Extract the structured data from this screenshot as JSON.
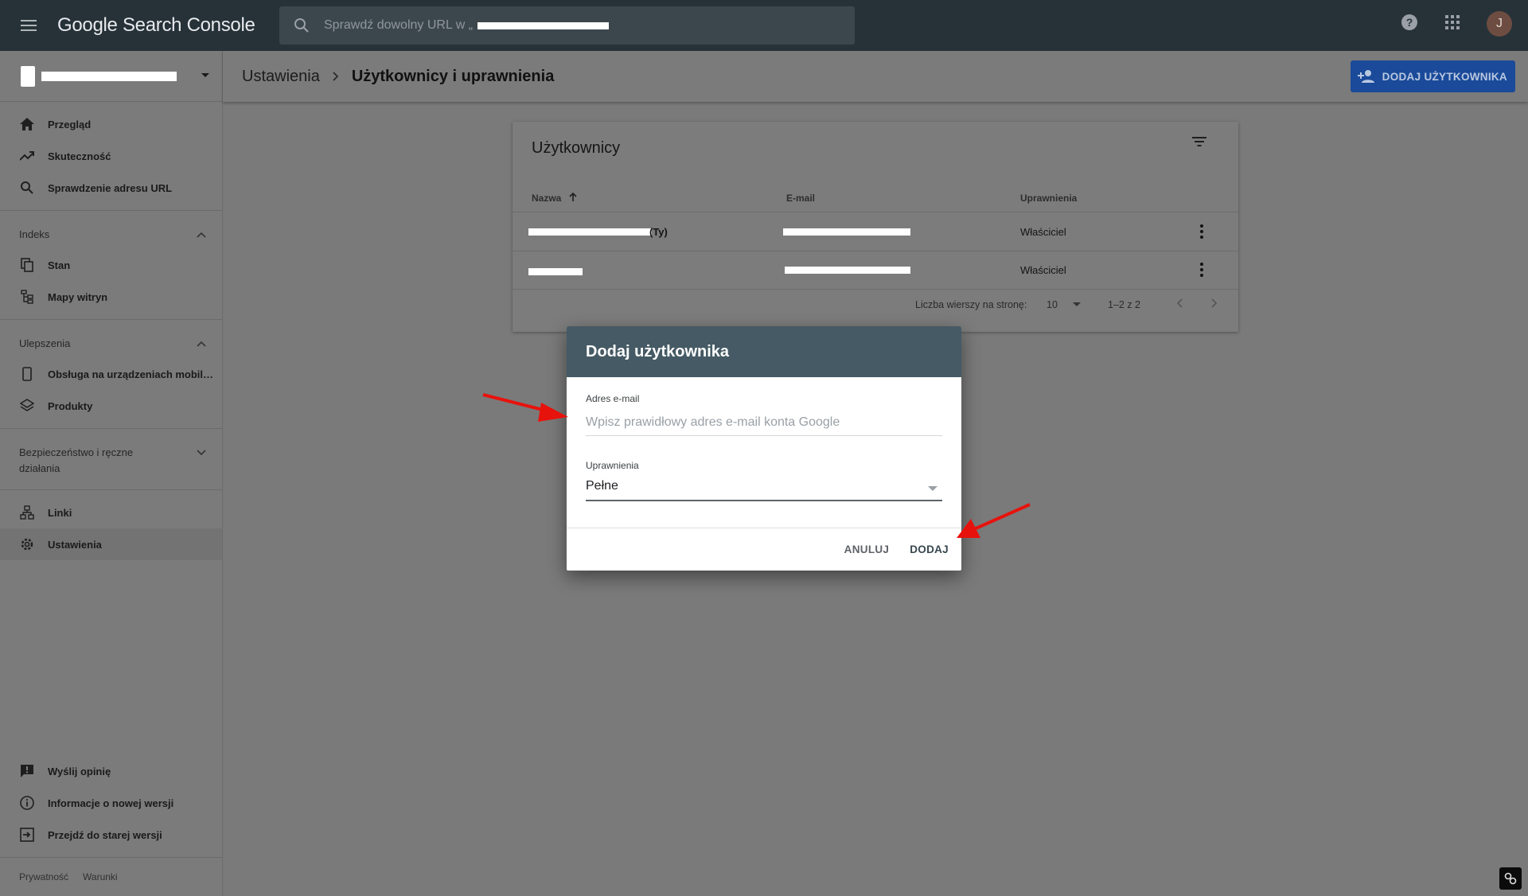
{
  "topbar": {
    "logo": "Google Search Console",
    "search_placeholder": "Sprawdź dowolny URL w „",
    "avatar_letter": "J"
  },
  "sidebar": {
    "items_main": [
      {
        "label": "Przegląd",
        "icon": "home-icon"
      },
      {
        "label": "Skuteczność",
        "icon": "trending-up-icon"
      },
      {
        "label": "Sprawdzenie adresu URL",
        "icon": "search-icon"
      }
    ],
    "sections": {
      "indeks": "Indeks",
      "ulepszenia": "Ulepszenia",
      "bezpieczenstwo": "Bezpieczeństwo i ręczne działania"
    },
    "items_indeks": [
      {
        "label": "Stan",
        "icon": "copy-icon"
      },
      {
        "label": "Mapy witryn",
        "icon": "sitemap-icon"
      }
    ],
    "items_ulepszenia": [
      {
        "label": "Obsługa na urządzeniach mobil…",
        "icon": "phone-icon"
      },
      {
        "label": "Produkty",
        "icon": "layers-icon"
      }
    ],
    "items_other": [
      {
        "label": "Linki",
        "icon": "links-icon"
      },
      {
        "label": "Ustawienia",
        "icon": "gear-icon"
      }
    ],
    "items_bottom": [
      {
        "label": "Wyślij opinię",
        "icon": "feedback-icon"
      },
      {
        "label": "Informacje o nowej wersji",
        "icon": "info-icon"
      },
      {
        "label": "Przejdź do starej wersji",
        "icon": "exit-icon"
      }
    ],
    "footer": {
      "privacy": "Prywatność",
      "terms": "Warunki"
    }
  },
  "header": {
    "breadcrumb_parent": "Ustawienia",
    "breadcrumb_current": "Użytkownicy i uprawnienia",
    "add_user_button": "DODAJ UŻYTKOWNIKA"
  },
  "users_card": {
    "title": "Użytkownicy",
    "columns": [
      "Nazwa",
      "E-mail",
      "Uprawnienia"
    ],
    "rows": [
      {
        "name_suffix": "(Ty)",
        "permission": "Właściciel"
      },
      {
        "name_suffix": "",
        "permission": "Właściciel"
      }
    ],
    "pager": {
      "rows_label": "Liczba wierszy na stronę:",
      "rows_value": "10",
      "range": "1–2 z 2"
    }
  },
  "dialog": {
    "title": "Dodaj użytkownika",
    "email_label": "Adres e-mail",
    "email_placeholder": "Wpisz prawidłowy adres e-mail konta Google",
    "permission_label": "Uprawnienia",
    "permission_value": "Pełne",
    "cancel": "ANULUJ",
    "add": "DODAJ"
  },
  "colors": {
    "topbar": "#263238",
    "dialog_header": "#455a64",
    "accent_blue": "#1a73e8",
    "arrow_red": "#e8120c"
  }
}
